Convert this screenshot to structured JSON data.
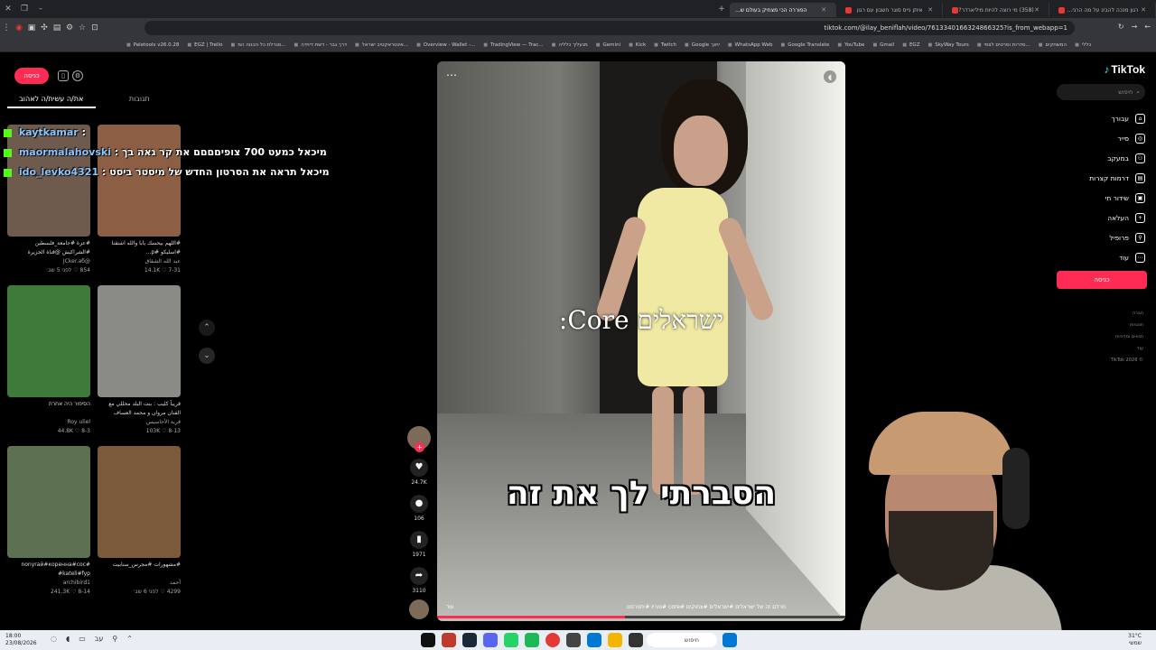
{
  "browser": {
    "tabs": [
      {
        "title": "רגון מנכה להביג על מה הרגי..."
      },
      {
        "title": "(358) מי רוצה להיות מיליארדר?"
      },
      {
        "title": "איתן נייס סוגר חשבון עם רגון"
      },
      {
        "title": "הפוררה הכי מצחיק בעולם ש..."
      }
    ],
    "url": "tiktok.com/@ilay_beniflah/video/7613340166324866325?is_from_webapp=1",
    "bookmarks": [
      "Paletools v26.0.28",
      "EGZ | Trello",
      "סגרלת כל הכנוה המ...",
      "דרך גבר - דשת דיוידה",
      "אינטראקטיב ישראל...",
      "Overview - Wallet -...",
      "TradingView — Trac...",
      "מנעליך כלליה",
      "Gemini",
      "Kick",
      "Twitch",
      "Google יחנך",
      "WhatsApp Web",
      "Google Translate",
      "YouTube",
      "Gmail",
      "EGZ",
      "SkyWay Tours",
      "סדרות וסרטים לצפי...",
      "המשחקים",
      "כללי"
    ]
  },
  "tiktok": {
    "logo": "TikTok",
    "search_placeholder": "חיפוש",
    "nav": [
      {
        "label": "עבורך",
        "icon": "home-icon",
        "glyph": "⌂"
      },
      {
        "label": "סייר",
        "icon": "compass-icon",
        "glyph": "◎"
      },
      {
        "label": "במעקב",
        "icon": "following-icon",
        "glyph": "⚇"
      },
      {
        "label": "דרמות קצרות",
        "icon": "drama-icon",
        "glyph": "▤"
      },
      {
        "label": "שידור חי",
        "icon": "live-icon",
        "glyph": "▣"
      },
      {
        "label": "העלאה",
        "icon": "upload-icon",
        "glyph": "+"
      },
      {
        "label": "פרופיל",
        "icon": "profile-icon",
        "glyph": "⚲"
      },
      {
        "label": "עוד",
        "icon": "more-icon",
        "glyph": "⋯"
      }
    ],
    "login_label": "כניסה",
    "footer": [
      "חברה",
      "תוכניות",
      "תנאים ומדיניות",
      "עוד",
      "© TikTok 2026"
    ],
    "left_tabs": {
      "comments": "תגובות",
      "liked": "את/ה עשית/ה לאהוב"
    },
    "grid": [
      {
        "caption": "#عزة #جامعة_فلسطين #الشراكيش @قناة الجزيرة",
        "author": "@JCker.аб",
        "views": "854",
        "date": "לפני 5 שב׳",
        "bg": "#6f5a4e"
      },
      {
        "caption": "#اللهم بيحسك يابا والله اشتقنا #اسليكو #p...",
        "author": "عبد الله الشقاق",
        "views": "14.1K",
        "date": "7-31",
        "bg": "#8c5f44"
      },
      {
        "caption": "הסיפור היה אחרת",
        "author": "Roy uliel",
        "views": "44.8K",
        "date": "8-3",
        "bg": "#3f7a3a"
      },
      {
        "caption": "قريباً كليب : بنت البلد محللي مع الفنان مروان و محمد العساف",
        "author": "قرية الأحاسيس",
        "views": "103K",
        "date": "8-13",
        "bg": "#8a8a86"
      },
      {
        "caption": "nonyrай#коренна#coc# kateli#fyp#",
        "author": "archibird1",
        "views": "241.3K",
        "date": "8-14",
        "bg": "#5d7052"
      },
      {
        "caption": "#مشهورات #مجرس_سنابيت",
        "author": "أحمد",
        "views": "4299",
        "date": "לפני 6 שב׳",
        "bg": "#7a5a3a"
      }
    ],
    "video": {
      "overlay_top": "ישראלים Core:",
      "overlay_bottom": "הסברתי לך את זה",
      "caption": "תרלם זה של ישראלים #ישראלים #צחוקים #core #פוריו #יתפרסם",
      "more_label": "עוד",
      "progress": 0.46
    },
    "actions": {
      "likes": "24.7K",
      "comments": "106",
      "saves": "1971",
      "shares": "3110"
    }
  },
  "chat": [
    {
      "user": "kaytkamar",
      "msg": ":"
    },
    {
      "user": "maormalahovski",
      "msg": ": מיכאל כמעט 700 צופיםםםם את קר גאה בך"
    },
    {
      "user": "ido_levko4321",
      "msg": ": מיכאל תראה את הסרטון החדש של מיסטר ביסט"
    }
  ],
  "taskbar": {
    "time": "18:00",
    "date": "23/08/2026",
    "search_placeholder": "חיפוש",
    "weather_temp": "31°C",
    "weather_desc": "שמשי"
  },
  "colors": {
    "brand": "#fe2c55",
    "accent": "#25f4ee",
    "kick": "#53fc18"
  }
}
